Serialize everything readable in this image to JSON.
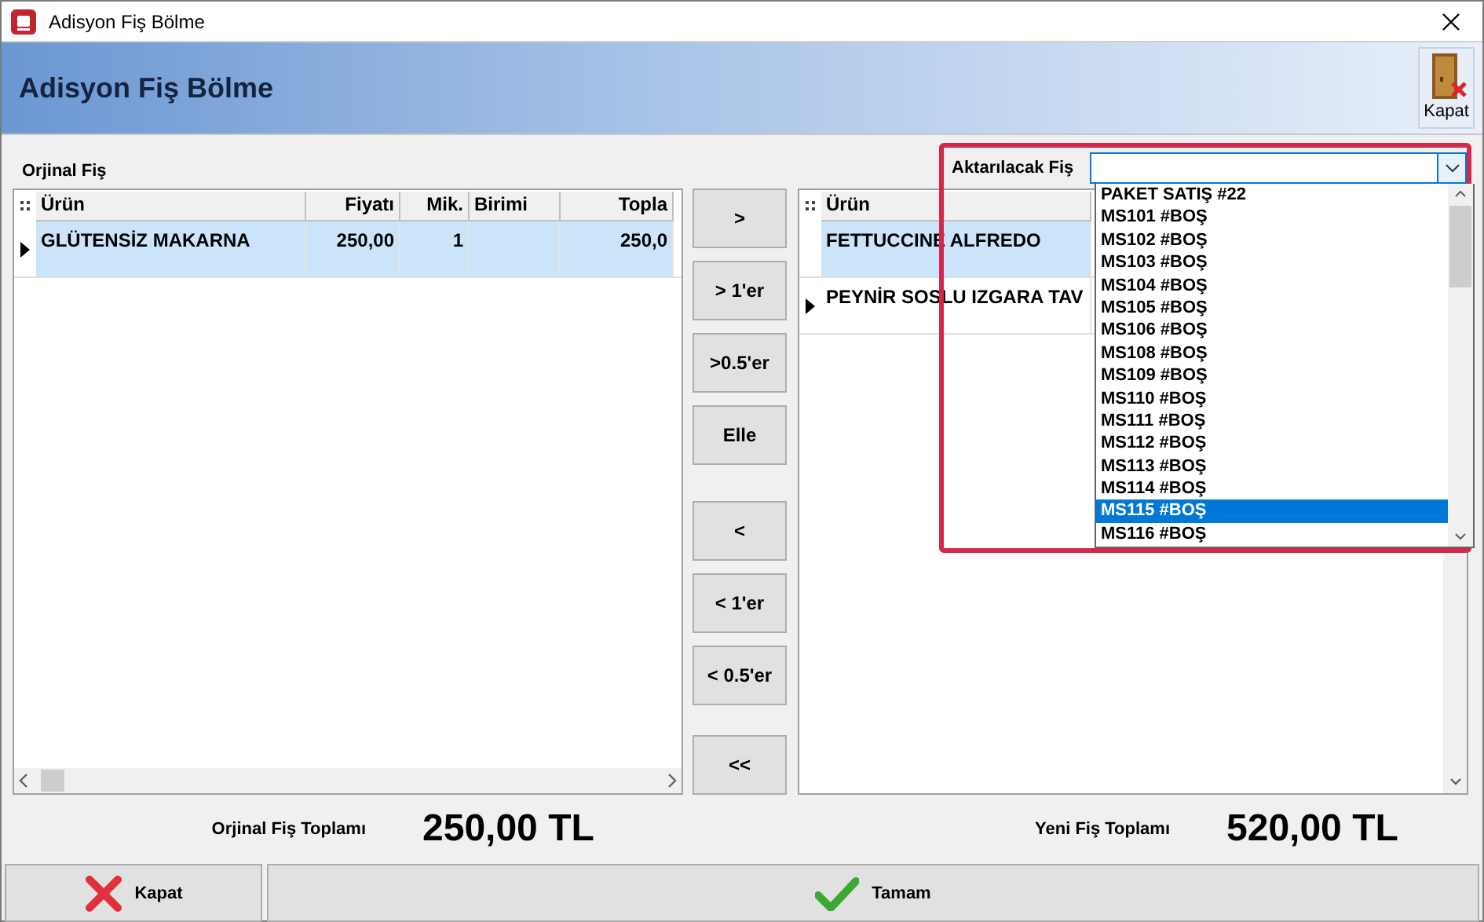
{
  "window": {
    "title": "Adisyon Fiş Bölme"
  },
  "header": {
    "title": "Adisyon Fiş Bölme",
    "close_button": "Kapat"
  },
  "original_receipt": {
    "label": "Orjinal Fiş",
    "columns": [
      {
        "label": "Ürün",
        "kind": "text"
      },
      {
        "label": "Fiyatı",
        "kind": "number"
      },
      {
        "label": "Mik.",
        "kind": "number"
      },
      {
        "label": "Birimi",
        "kind": "text"
      },
      {
        "label": "Topla",
        "kind": "number"
      }
    ],
    "rows": [
      {
        "cells": [
          "GLÜTENSİZ MAKARNA",
          "250,00",
          "1",
          "",
          "250,0"
        ],
        "selected": true,
        "current": true
      }
    ]
  },
  "move_buttons": [
    [
      ">",
      "> 1'er",
      ">0.5'er",
      "Elle"
    ],
    [
      "<",
      "< 1'er",
      "< 0.5'er"
    ],
    [
      "<<"
    ]
  ],
  "new_receipt": {
    "columns": [
      {
        "label": "Ürün",
        "kind": "text"
      }
    ],
    "rows": [
      {
        "cells": [
          "FETTUCCINE ALFREDO"
        ],
        "selected": true,
        "current": false
      },
      {
        "cells": [
          "PEYNİR SOSLU IZGARA TAV"
        ],
        "selected": false,
        "current": true
      }
    ]
  },
  "target_dropdown": {
    "label": "Aktarılacak Fiş",
    "items": [
      {
        "label": "PAKET SATIŞ #22",
        "selected": false
      },
      {
        "label": "MS101 #BOŞ",
        "selected": false
      },
      {
        "label": "MS102 #BOŞ",
        "selected": false
      },
      {
        "label": "MS103 #BOŞ",
        "selected": false
      },
      {
        "label": "MS104 #BOŞ",
        "selected": false
      },
      {
        "label": "MS105 #BOŞ",
        "selected": false
      },
      {
        "label": "MS106 #BOŞ",
        "selected": false
      },
      {
        "label": "MS108 #BOŞ",
        "selected": false
      },
      {
        "label": "MS109 #BOŞ",
        "selected": false
      },
      {
        "label": "MS110 #BOŞ",
        "selected": false
      },
      {
        "label": "MS111 #BOŞ",
        "selected": false
      },
      {
        "label": "MS112 #BOŞ",
        "selected": false
      },
      {
        "label": "MS113 #BOŞ",
        "selected": false
      },
      {
        "label": "MS114 #BOŞ",
        "selected": false
      },
      {
        "label": "MS115 #BOŞ",
        "selected": true
      },
      {
        "label": "MS116 #BOŞ",
        "selected": false
      }
    ]
  },
  "totals": [
    {
      "label": "Orjinal Fiş Toplamı",
      "value": "250,00 TL"
    },
    {
      "label": "Yeni Fiş Toplamı",
      "value": "520,00 TL"
    }
  ],
  "footer_buttons": [
    {
      "label": "Kapat",
      "kind": "close"
    },
    {
      "label": "Tamam",
      "kind": "ok"
    }
  ]
}
